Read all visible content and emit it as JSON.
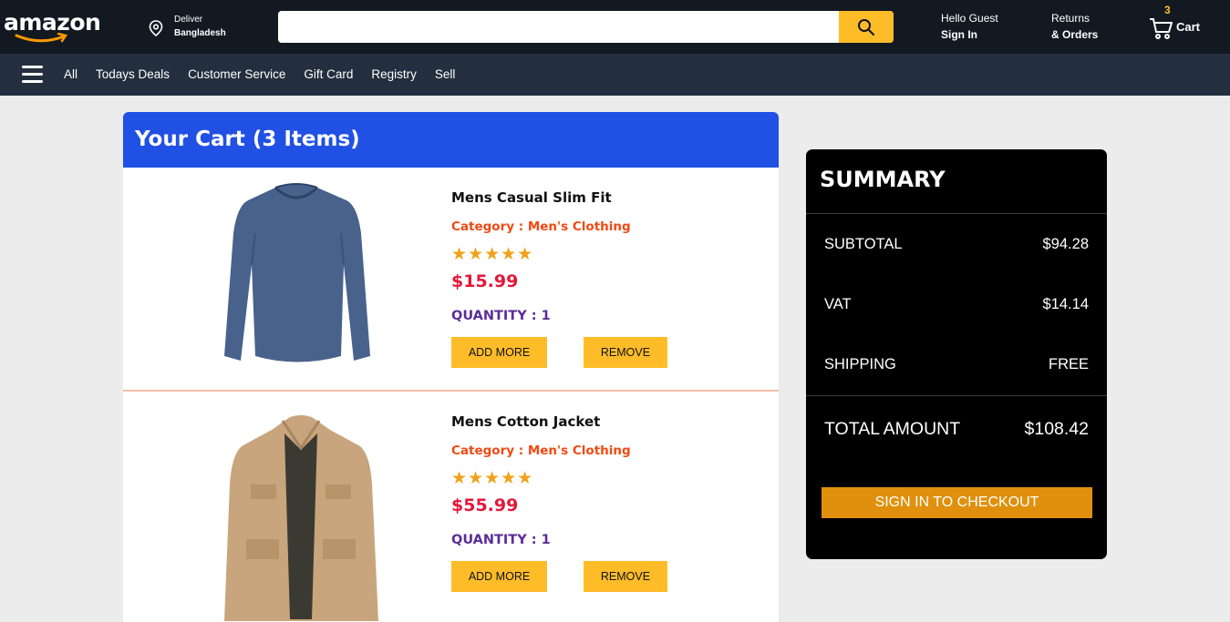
{
  "header": {
    "logo_text": "amazon",
    "deliver_label": "Deliver",
    "deliver_location": "Bangladesh",
    "search": {
      "placeholder": "",
      "value": ""
    },
    "account": {
      "greeting": "Hello Guest",
      "action": "Sign In"
    },
    "orders": {
      "line1": "Returns",
      "line2": "& Orders"
    },
    "cart": {
      "count": "3",
      "label": "Cart"
    }
  },
  "nav": {
    "links": [
      "All",
      "Todays Deals",
      "Customer Service",
      "Gift Card",
      "Registry",
      "Sell"
    ]
  },
  "cart_panel": {
    "title": "Your Cart (3 Items)",
    "items": [
      {
        "name": "Mens Casual Slim Fit",
        "category": "Category : Men's Clothing",
        "rating": "★★★★★",
        "price": "$15.99",
        "quantity": "QUANTITY : 1",
        "add_label": "ADD MORE",
        "remove_label": "REMOVE"
      },
      {
        "name": "Mens Cotton Jacket",
        "category": "Category : Men's Clothing",
        "rating": "★★★★★",
        "price": "$55.99",
        "quantity": "QUANTITY : 1",
        "add_label": "ADD MORE",
        "remove_label": "REMOVE"
      }
    ]
  },
  "summary": {
    "title": "SUMMARY",
    "rows": [
      {
        "label": "SUBTOTAL",
        "value": "$94.28"
      },
      {
        "label": "VAT",
        "value": "$14.14"
      },
      {
        "label": "SHIPPING",
        "value": "FREE"
      }
    ],
    "total": {
      "label": "TOTAL AMOUNT",
      "value": "$108.42"
    },
    "checkout_label": "SIGN IN TO CHECKOUT"
  },
  "colors": {
    "header_bg": "#131921",
    "nav_bg": "#232f3e",
    "accent": "#febd28",
    "cart_header": "#2150e4",
    "price": "#e4173a",
    "category": "#f04a13",
    "quantity": "#5b2c98",
    "checkout": "#e0900d"
  }
}
